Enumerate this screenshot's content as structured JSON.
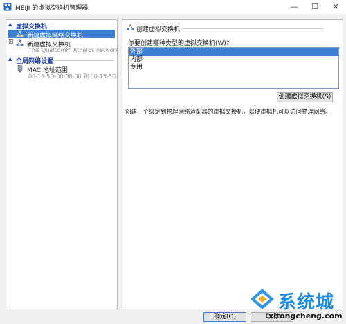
{
  "window": {
    "title": "MEIJI 的虚拟交换机管理器",
    "minimize_glyph": "—",
    "maximize_glyph": "☐",
    "close_glyph": "✕"
  },
  "sidebar": {
    "section_virtual_switches": "虚拟交换机",
    "new_switch_label": "新建虚拟网络交换机",
    "existing_switch_label": "新建虚拟交换机",
    "existing_switch_sub": "This Qualcomm Atheros network C...",
    "section_global": "全局网络设置",
    "mac_label": "MAC 地址范围",
    "mac_range": "00-15-5D-00-08-00 到 00-15-5D-0..."
  },
  "panel": {
    "title": "创建虚拟交换机",
    "question": "你要创建哪种类型的虚拟交换机(W)?",
    "options": [
      "外部",
      "内部",
      "专用"
    ],
    "selected_option": "外部",
    "create_button": "创建虚拟交换机(S)",
    "description": "创建一个绑定到物理网络适配器的虚拟交换机，以便虚拟机可以访问物理网络。"
  },
  "footer": {
    "ok_button": "确定(O)",
    "cancel_button": "取消"
  },
  "watermark": {
    "brand": "系统城",
    "url": "xitongcheng.com"
  },
  "colors": {
    "selection": "#3d7fd3",
    "section_header": "#1e3fa0",
    "watermark_blue": "#1d8be0"
  },
  "icons": {
    "app": "switch-manager-icon",
    "network": "network-switch-icon",
    "mac": "network-adapter-icon",
    "expand": "expand-plus-icon",
    "collapse": "chevron-up-icon"
  }
}
